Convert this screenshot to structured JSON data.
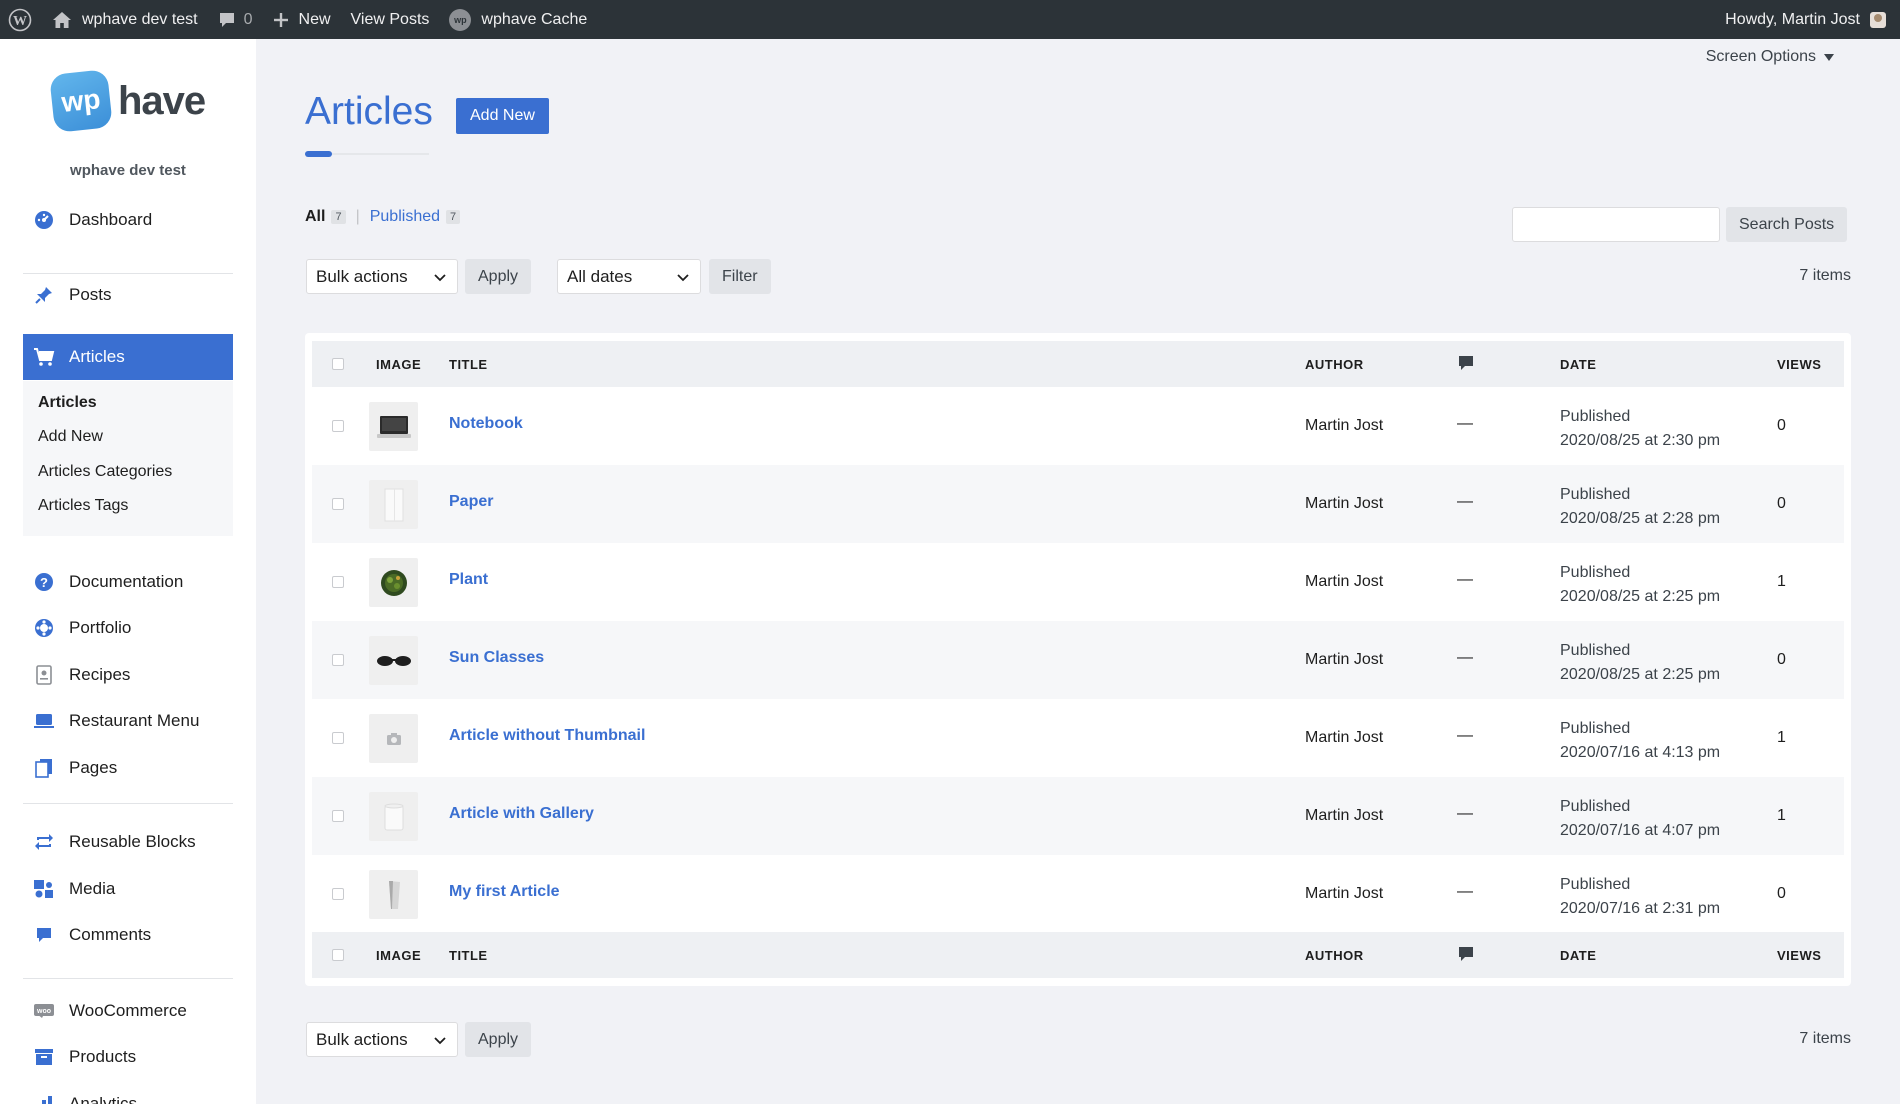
{
  "admin_bar": {
    "site_name": "wphave dev test",
    "comments_count": "0",
    "new_label": "New",
    "view_posts_label": "View Posts",
    "cache_label": "wphave Cache",
    "cache_badge": "wp",
    "greeting": "Howdy, Martin Jost"
  },
  "sidebar": {
    "logo_badge": "wp",
    "logo_text": "have",
    "site_name": "wphave dev test",
    "items": [
      {
        "label": "Dashboard",
        "icon": "dashboard-icon"
      },
      {
        "label": "Posts",
        "icon": "pin-icon"
      },
      {
        "label": "Articles",
        "icon": "cart-icon",
        "active": true
      },
      {
        "label": "Documentation",
        "icon": "help-icon"
      },
      {
        "label": "Portfolio",
        "icon": "portfolio-icon"
      },
      {
        "label": "Recipes",
        "icon": "recipes-icon"
      },
      {
        "label": "Restaurant Menu",
        "icon": "restaurant-icon"
      },
      {
        "label": "Pages",
        "icon": "pages-icon"
      },
      {
        "label": "Reusable Blocks",
        "icon": "reusable-blocks-icon"
      },
      {
        "label": "Media",
        "icon": "media-icon"
      },
      {
        "label": "Comments",
        "icon": "comments-icon"
      },
      {
        "label": "WooCommerce",
        "icon": "woocommerce-icon"
      },
      {
        "label": "Products",
        "icon": "products-icon"
      },
      {
        "label": "Analytics",
        "icon": "analytics-icon"
      }
    ],
    "submenu": [
      "Articles",
      "Add New",
      "Articles Categories",
      "Articles Tags"
    ]
  },
  "screen_options": "Screen Options",
  "page": {
    "title": "Articles",
    "add_new": "Add New"
  },
  "filters": {
    "all_label": "All",
    "all_count": "7",
    "published_label": "Published",
    "published_count": "7",
    "search_button": "Search Posts",
    "search_value": "",
    "bulk_actions": "Bulk actions",
    "apply": "Apply",
    "dates": "All dates",
    "filter": "Filter",
    "items_count": "7 items"
  },
  "table": {
    "columns": {
      "image": "IMAGE",
      "title": "TITLE",
      "author": "AUTHOR",
      "date": "DATE",
      "views": "VIEWS"
    },
    "rows": [
      {
        "title": "Notebook",
        "author": "Martin Jost",
        "comments": "—",
        "status": "Published",
        "date": "2020/08/25 at 2:30 pm",
        "views": "0",
        "thumb": "notebook"
      },
      {
        "title": "Paper",
        "author": "Martin Jost",
        "comments": "—",
        "status": "Published",
        "date": "2020/08/25 at 2:28 pm",
        "views": "0",
        "thumb": "paper"
      },
      {
        "title": "Plant",
        "author": "Martin Jost",
        "comments": "—",
        "status": "Published",
        "date": "2020/08/25 at 2:25 pm",
        "views": "1",
        "thumb": "plant"
      },
      {
        "title": "Sun Classes",
        "author": "Martin Jost",
        "comments": "—",
        "status": "Published",
        "date": "2020/08/25 at 2:25 pm",
        "views": "0",
        "thumb": "glasses"
      },
      {
        "title": "Article without Thumbnail",
        "author": "Martin Jost",
        "comments": "—",
        "status": "Published",
        "date": "2020/07/16 at 4:13 pm",
        "views": "1",
        "thumb": "camera-placeholder"
      },
      {
        "title": "Article with Gallery",
        "author": "Martin Jost",
        "comments": "—",
        "status": "Published",
        "date": "2020/07/16 at 4:07 pm",
        "views": "1",
        "thumb": "mug"
      },
      {
        "title": "My first Article",
        "author": "Martin Jost",
        "comments": "—",
        "status": "Published",
        "date": "2020/07/16 at 2:31 pm",
        "views": "0",
        "thumb": "cup"
      }
    ]
  },
  "colors": {
    "accent": "#3a6fd1",
    "admin_bar": "#2c3338",
    "background": "#f1f2f6"
  }
}
